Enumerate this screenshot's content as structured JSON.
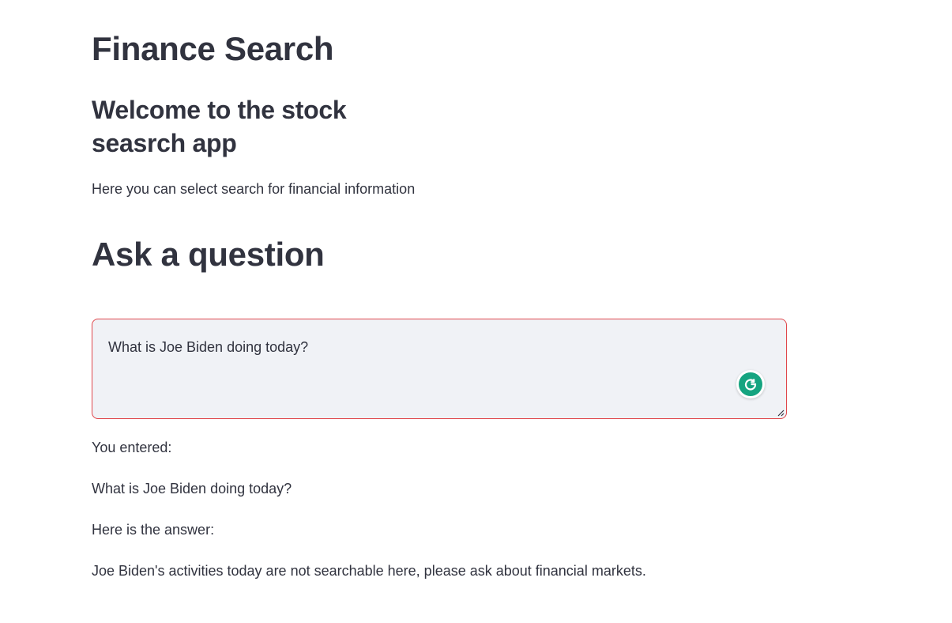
{
  "page": {
    "title": "Finance Search",
    "welcome_heading": "Welcome to the stock seasrch app",
    "intro_text": "Here you can select search for financial information",
    "ask_heading": "Ask a question"
  },
  "question": {
    "value": "What is Joe Biden doing today?",
    "grammarly_icon": "grammarly-g-icon",
    "accent_color": "#15a480",
    "border_color": "#e0474c"
  },
  "result": {
    "entered_label": "You entered:",
    "entered_value": "What is Joe Biden doing today?",
    "answer_label": "Here is the answer:",
    "answer_value": "Joe Biden's activities today are not searchable here, please ask about financial markets."
  }
}
